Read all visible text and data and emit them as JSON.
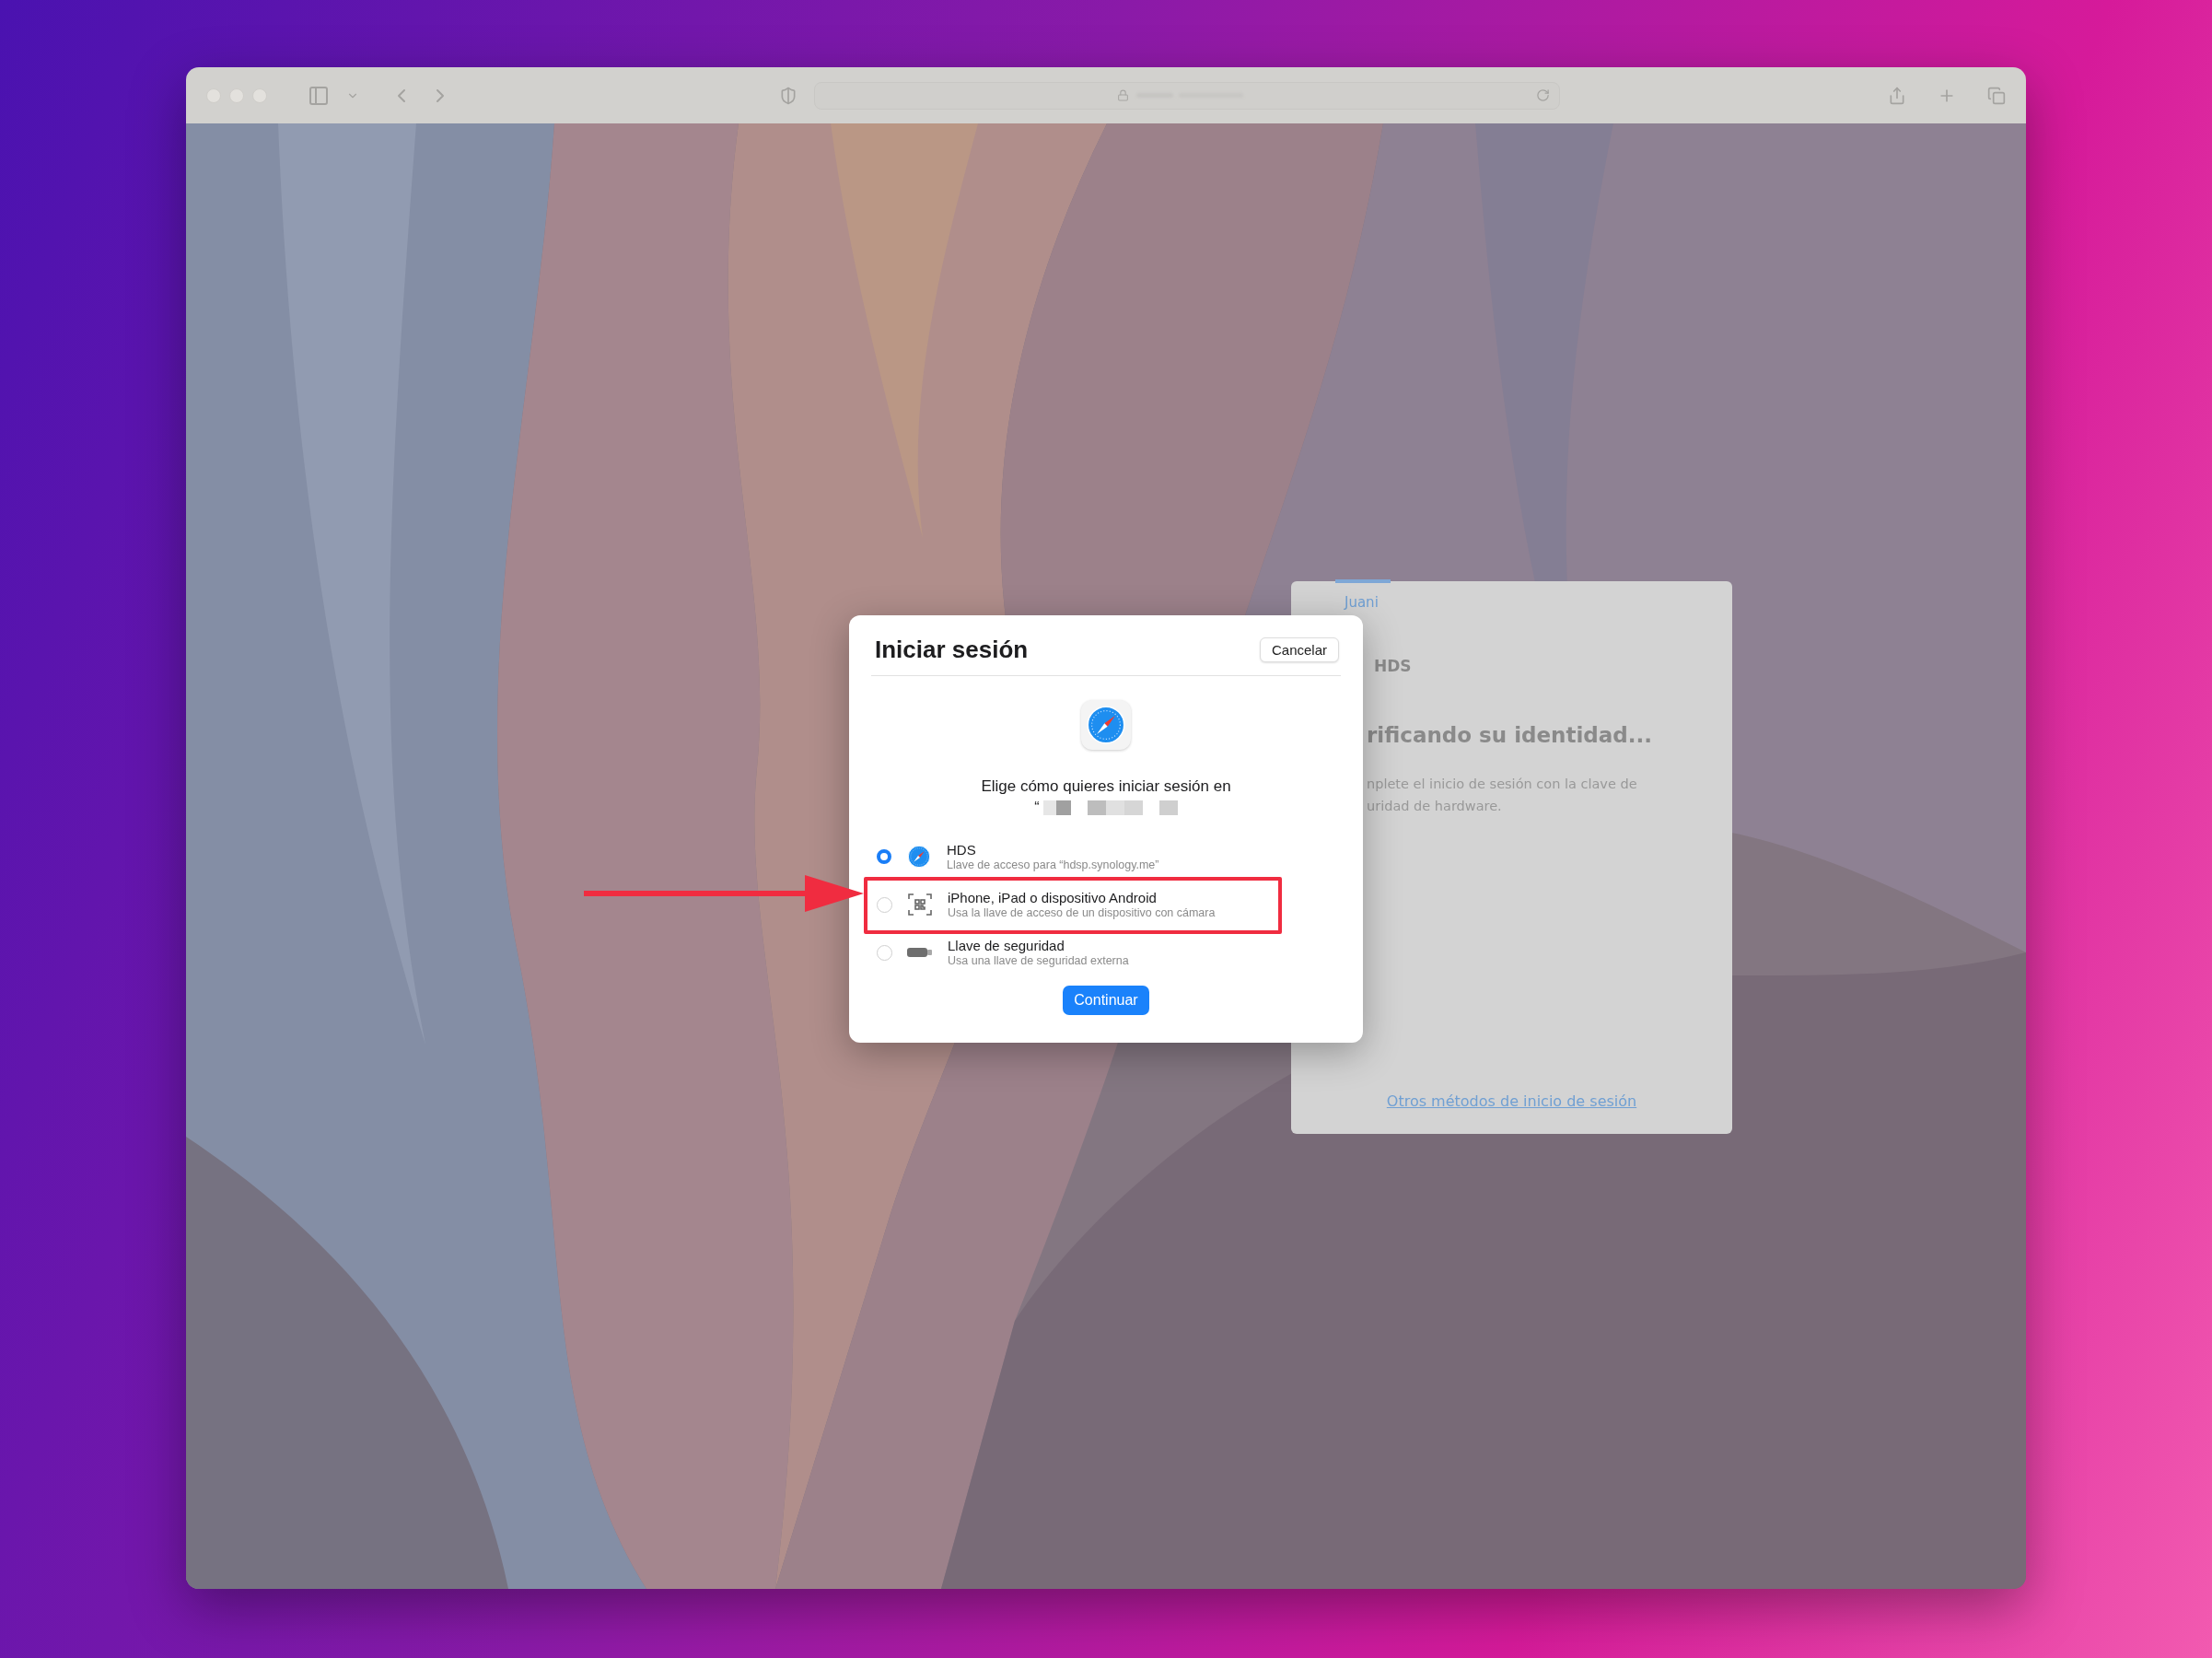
{
  "page": {
    "panel": {
      "user": "Juani",
      "app_name": "HDS",
      "heading": "rificando su identidad...",
      "message_lines": [
        "nplete el inicio de sesión con la clave de",
        "uridad de hardware."
      ],
      "link": "Otros métodos de inicio de sesión"
    }
  },
  "dialog": {
    "title": "Iniciar sesión",
    "cancel": "Cancelar",
    "prompt": "Elige cómo quieres iniciar sesión en",
    "site_prefix": "“",
    "options": [
      {
        "kind": "compass",
        "title": "HDS",
        "subtitle": "Llave de acceso para “hdsp.synology.me”",
        "selected": true
      },
      {
        "kind": "qr",
        "title": "iPhone, iPad o dispositivo Android",
        "subtitle": "Usa la llave de acceso de un dispositivo con cámara",
        "selected": false
      },
      {
        "kind": "key",
        "title": "Llave de seguridad",
        "subtitle": "Usa una llave de seguridad externa",
        "selected": false
      }
    ],
    "continue": "Continuar"
  }
}
